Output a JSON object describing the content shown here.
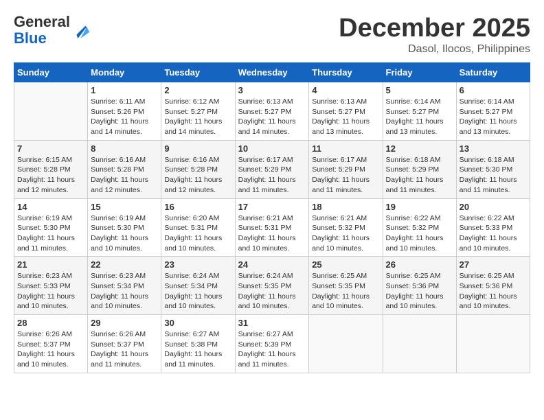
{
  "header": {
    "logo_general": "General",
    "logo_blue": "Blue",
    "month": "December 2025",
    "location": "Dasol, Ilocos, Philippines"
  },
  "days_of_week": [
    "Sunday",
    "Monday",
    "Tuesday",
    "Wednesday",
    "Thursday",
    "Friday",
    "Saturday"
  ],
  "weeks": [
    [
      {
        "day": "",
        "info": ""
      },
      {
        "day": "1",
        "info": "Sunrise: 6:11 AM\nSunset: 5:26 PM\nDaylight: 11 hours\nand 14 minutes."
      },
      {
        "day": "2",
        "info": "Sunrise: 6:12 AM\nSunset: 5:27 PM\nDaylight: 11 hours\nand 14 minutes."
      },
      {
        "day": "3",
        "info": "Sunrise: 6:13 AM\nSunset: 5:27 PM\nDaylight: 11 hours\nand 14 minutes."
      },
      {
        "day": "4",
        "info": "Sunrise: 6:13 AM\nSunset: 5:27 PM\nDaylight: 11 hours\nand 13 minutes."
      },
      {
        "day": "5",
        "info": "Sunrise: 6:14 AM\nSunset: 5:27 PM\nDaylight: 11 hours\nand 13 minutes."
      },
      {
        "day": "6",
        "info": "Sunrise: 6:14 AM\nSunset: 5:27 PM\nDaylight: 11 hours\nand 13 minutes."
      }
    ],
    [
      {
        "day": "7",
        "info": "Sunrise: 6:15 AM\nSunset: 5:28 PM\nDaylight: 11 hours\nand 12 minutes."
      },
      {
        "day": "8",
        "info": "Sunrise: 6:16 AM\nSunset: 5:28 PM\nDaylight: 11 hours\nand 12 minutes."
      },
      {
        "day": "9",
        "info": "Sunrise: 6:16 AM\nSunset: 5:28 PM\nDaylight: 11 hours\nand 12 minutes."
      },
      {
        "day": "10",
        "info": "Sunrise: 6:17 AM\nSunset: 5:29 PM\nDaylight: 11 hours\nand 11 minutes."
      },
      {
        "day": "11",
        "info": "Sunrise: 6:17 AM\nSunset: 5:29 PM\nDaylight: 11 hours\nand 11 minutes."
      },
      {
        "day": "12",
        "info": "Sunrise: 6:18 AM\nSunset: 5:29 PM\nDaylight: 11 hours\nand 11 minutes."
      },
      {
        "day": "13",
        "info": "Sunrise: 6:18 AM\nSunset: 5:30 PM\nDaylight: 11 hours\nand 11 minutes."
      }
    ],
    [
      {
        "day": "14",
        "info": "Sunrise: 6:19 AM\nSunset: 5:30 PM\nDaylight: 11 hours\nand 11 minutes."
      },
      {
        "day": "15",
        "info": "Sunrise: 6:19 AM\nSunset: 5:30 PM\nDaylight: 11 hours\nand 10 minutes."
      },
      {
        "day": "16",
        "info": "Sunrise: 6:20 AM\nSunset: 5:31 PM\nDaylight: 11 hours\nand 10 minutes."
      },
      {
        "day": "17",
        "info": "Sunrise: 6:21 AM\nSunset: 5:31 PM\nDaylight: 11 hours\nand 10 minutes."
      },
      {
        "day": "18",
        "info": "Sunrise: 6:21 AM\nSunset: 5:32 PM\nDaylight: 11 hours\nand 10 minutes."
      },
      {
        "day": "19",
        "info": "Sunrise: 6:22 AM\nSunset: 5:32 PM\nDaylight: 11 hours\nand 10 minutes."
      },
      {
        "day": "20",
        "info": "Sunrise: 6:22 AM\nSunset: 5:33 PM\nDaylight: 11 hours\nand 10 minutes."
      }
    ],
    [
      {
        "day": "21",
        "info": "Sunrise: 6:23 AM\nSunset: 5:33 PM\nDaylight: 11 hours\nand 10 minutes."
      },
      {
        "day": "22",
        "info": "Sunrise: 6:23 AM\nSunset: 5:34 PM\nDaylight: 11 hours\nand 10 minutes."
      },
      {
        "day": "23",
        "info": "Sunrise: 6:24 AM\nSunset: 5:34 PM\nDaylight: 11 hours\nand 10 minutes."
      },
      {
        "day": "24",
        "info": "Sunrise: 6:24 AM\nSunset: 5:35 PM\nDaylight: 11 hours\nand 10 minutes."
      },
      {
        "day": "25",
        "info": "Sunrise: 6:25 AM\nSunset: 5:35 PM\nDaylight: 11 hours\nand 10 minutes."
      },
      {
        "day": "26",
        "info": "Sunrise: 6:25 AM\nSunset: 5:36 PM\nDaylight: 11 hours\nand 10 minutes."
      },
      {
        "day": "27",
        "info": "Sunrise: 6:25 AM\nSunset: 5:36 PM\nDaylight: 11 hours\nand 10 minutes."
      }
    ],
    [
      {
        "day": "28",
        "info": "Sunrise: 6:26 AM\nSunset: 5:37 PM\nDaylight: 11 hours\nand 10 minutes."
      },
      {
        "day": "29",
        "info": "Sunrise: 6:26 AM\nSunset: 5:37 PM\nDaylight: 11 hours\nand 11 minutes."
      },
      {
        "day": "30",
        "info": "Sunrise: 6:27 AM\nSunset: 5:38 PM\nDaylight: 11 hours\nand 11 minutes."
      },
      {
        "day": "31",
        "info": "Sunrise: 6:27 AM\nSunset: 5:39 PM\nDaylight: 11 hours\nand 11 minutes."
      },
      {
        "day": "",
        "info": ""
      },
      {
        "day": "",
        "info": ""
      },
      {
        "day": "",
        "info": ""
      }
    ]
  ]
}
